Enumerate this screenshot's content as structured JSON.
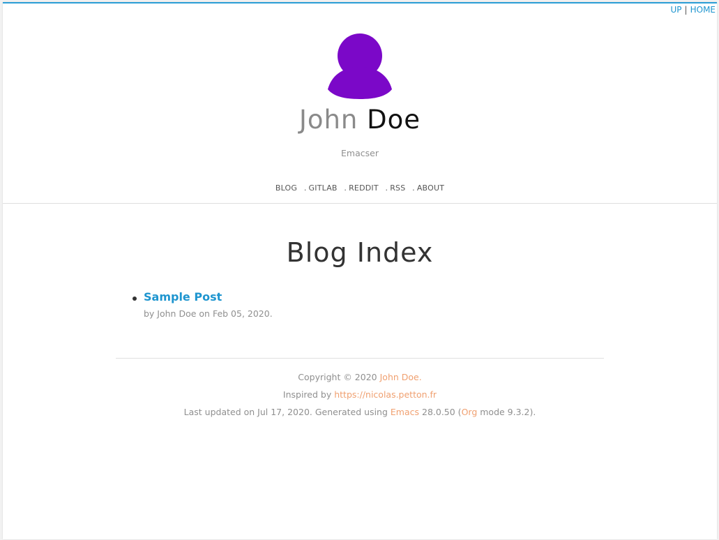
{
  "top_nav": {
    "up": "UP",
    "separator": "|",
    "home": "HOME"
  },
  "header": {
    "first_name": "John",
    "last_name": "Doe",
    "tagline": "Emacser",
    "avatar_color": "#7b08c8",
    "nav": [
      {
        "label": "BLOG"
      },
      {
        "label": "GITLAB"
      },
      {
        "label": "REDDIT"
      },
      {
        "label": "RSS"
      },
      {
        "label": "ABOUT"
      }
    ],
    "nav_separator": "."
  },
  "main": {
    "title": "Blog Index",
    "posts": [
      {
        "title": "Sample Post",
        "meta": "by John Doe on Feb 05, 2020."
      }
    ]
  },
  "footer": {
    "copyright_prefix": "Copyright © 2020",
    "copyright_link": "John Doe.",
    "inspired_prefix": "Inspired by",
    "inspired_link": "https://nicolas.petton.fr",
    "updated_prefix": "Last updated on Jul 17, 2020. Generated using",
    "emacs_link": "Emacs",
    "emacs_version": "28.0.50 (",
    "org_link": "Org",
    "org_suffix": "mode 9.3.2)."
  },
  "colors": {
    "accent": "#1e95cf",
    "footer_link": "#f0a070",
    "avatar": "#7b08c8"
  }
}
